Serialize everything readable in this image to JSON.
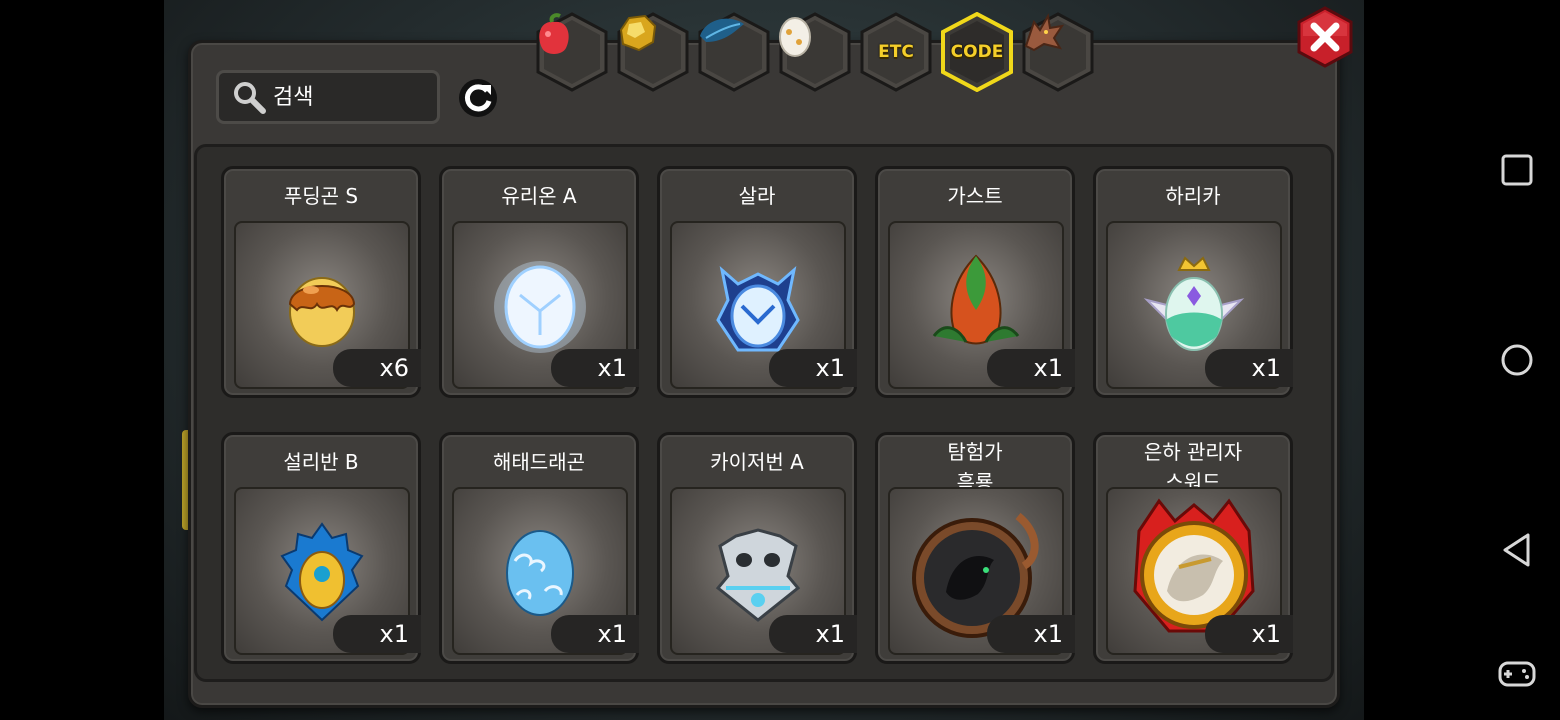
{
  "search": {
    "placeholder": "검색",
    "value": ""
  },
  "tabs": [
    {
      "id": "fruit",
      "icon": "fruit-icon",
      "active": false
    },
    {
      "id": "gold",
      "icon": "gold-ore-icon",
      "active": false
    },
    {
      "id": "feather",
      "icon": "feather-icon",
      "active": false
    },
    {
      "id": "egg",
      "icon": "egg-icon",
      "active": false
    },
    {
      "id": "etc",
      "label": "ETC",
      "active": false
    },
    {
      "id": "code",
      "label": "CODE",
      "active": true
    },
    {
      "id": "dragon",
      "icon": "dragon-icon",
      "active": false
    }
  ],
  "items": [
    {
      "name": "푸딩곤 S",
      "qty": "x6",
      "art": "pudding-egg"
    },
    {
      "name": "유리온 A",
      "qty": "x1",
      "art": "glowing-white-egg"
    },
    {
      "name": "살라",
      "qty": "x1",
      "art": "blue-armored-egg"
    },
    {
      "name": "가스트",
      "qty": "x1",
      "art": "leaf-egg"
    },
    {
      "name": "하리카",
      "qty": "x1",
      "art": "crowned-crystal-egg"
    },
    {
      "name": "설리반 B",
      "qty": "x1",
      "art": "peacock-egg"
    },
    {
      "name": "해태드래곤",
      "qty": "x1",
      "art": "cloud-egg"
    },
    {
      "name": "카이저번 A",
      "qty": "x1",
      "art": "skull-egg"
    },
    {
      "name_line1": "탐험가",
      "name_line2": "흑룡",
      "qty": "x1",
      "art": "black-dragon-emblem"
    },
    {
      "name_line1": "은하 관리자",
      "name_line2": "스워드",
      "qty": "x1",
      "art": "gold-dragon-emblem"
    }
  ],
  "colors": {
    "accent": "#f5cf2a",
    "close": "#c8202a",
    "panel": "#3a3836"
  }
}
